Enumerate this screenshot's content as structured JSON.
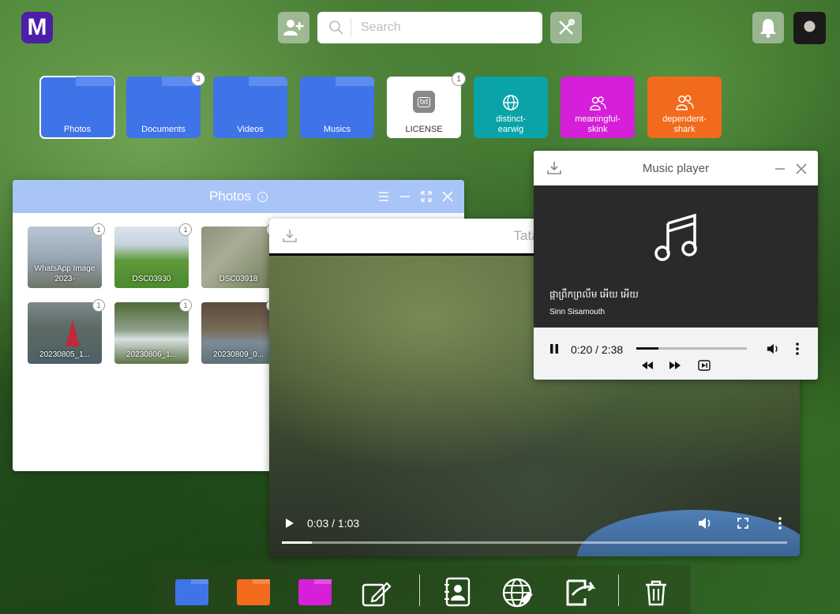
{
  "logo": {
    "text": "M"
  },
  "search": {
    "placeholder": "Search"
  },
  "desktop_icons": [
    {
      "label": "Photos",
      "badge": ""
    },
    {
      "label": "Documents",
      "badge": "3"
    },
    {
      "label": "Videos",
      "badge": ""
    },
    {
      "label": "Musics",
      "badge": ""
    },
    {
      "label": "LICENSE",
      "badge": "1",
      "file_tag": "txt"
    },
    {
      "label": "distinct-earwig",
      "badge": ""
    },
    {
      "label": "meaningful-skink",
      "badge": ""
    },
    {
      "label": "dependent-shark",
      "badge": ""
    }
  ],
  "photos_window": {
    "title": "Photos",
    "items": [
      {
        "label": "WhatsApp Image 2023-",
        "badge": "1"
      },
      {
        "label": "DSC03930",
        "badge": "1"
      },
      {
        "label": "DSC03918",
        "badge": "1"
      },
      {
        "label": "20230805_1...",
        "badge": "1"
      },
      {
        "label": "20230806_1...",
        "badge": "1"
      },
      {
        "label": "20230809_0...",
        "badge": "1"
      }
    ]
  },
  "video_window": {
    "title": "Tatal R",
    "time": "0:03 / 1:03",
    "progress": 0.06
  },
  "music_window": {
    "title": "Music player",
    "track": "ផ្កាព្រឹកព្រលឹម អើយ អើយ",
    "artist": "Sinn Sisamouth",
    "time": "0:20 / 2:38",
    "progress": 0.2
  },
  "colors": {
    "accent_blue": "#3f73e8",
    "teal": "#0aa4a8",
    "magenta": "#d51fd8",
    "orange": "#f26b1d",
    "logo": "#4b1fa8"
  }
}
